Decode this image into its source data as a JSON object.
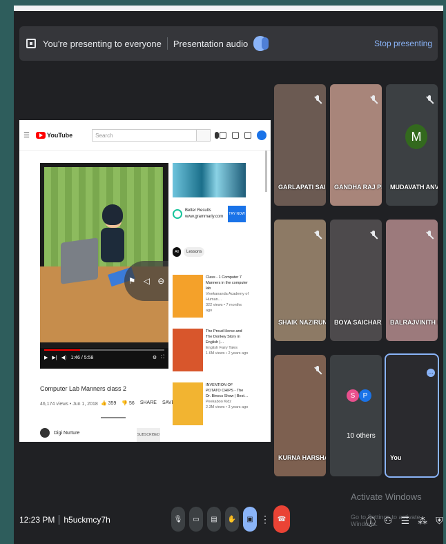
{
  "banner": {
    "presenting_text": "You're presenting to everyone",
    "audio_label": "Presentation audio",
    "stop_label": "Stop presenting"
  },
  "youtube": {
    "brand": "YouTube",
    "search_placeholder": "Search",
    "video_title": "Computer Lab Manners class 2",
    "video_meta": "46,174 views • Jun 1, 2018",
    "likes": "359",
    "dislikes": "56",
    "share_label": "SHARE",
    "save_label": "SAVE",
    "channel_name": "Digi Nurture",
    "subscribe_label": "SUBSCRIBED",
    "player_time": "1:46 / 5:58",
    "ad": {
      "title": "Better Results",
      "url": "www.grammarly.com",
      "button": "TRY NOW"
    },
    "chips": [
      "All",
      "Lessons"
    ],
    "recommendations": [
      {
        "title": "Class - 1 Computer 7 Manners in the computer lab",
        "channel": "Vivekananda Academy of Human…",
        "meta": "322 views • 7 months ago",
        "color": "#f4a12a"
      },
      {
        "title": "The Proud Horse and The Donkey Story in English |…",
        "channel": "English Fairy Tales",
        "meta": "1.6M views • 2 years ago",
        "color": "#d8562c"
      },
      {
        "title": "INVENTION OF POTATO CHIPS - The Dr. Binocs Show | Best…",
        "channel": "Peekaboo Kidz",
        "meta": "2.3M views • 3 years ago",
        "color": "#f2b431"
      }
    ]
  },
  "participants": [
    {
      "name": "GARLAPATI SAIS...",
      "bg": "#6b5a52"
    },
    {
      "name": "GANDHA RAJ PRA...",
      "bg": "#a8857a"
    },
    {
      "name": "MUDAVATH ANVIT...",
      "bg": "#3c4043",
      "initial": "M"
    },
    {
      "name": "SHAIK NAZIRUNN...",
      "bg": "#8d7a65"
    },
    {
      "name": "BOYA SAICHARAN...",
      "bg": "#4d4a4c"
    },
    {
      "name": "BALRAJVINITH IB",
      "bg": "#9c7a7c"
    },
    {
      "name": "KURNA HARSHA V...",
      "bg": "#7d6050"
    },
    {
      "name": "10 others",
      "bg": "#3c4043"
    },
    {
      "name": "You",
      "bg": "#2a2a2e"
    }
  ],
  "others_avatars": [
    {
      "letter": "S",
      "color": "#e8508d"
    },
    {
      "letter": "P",
      "color": "#1a73e8"
    }
  ],
  "bottom": {
    "time": "12:23 PM",
    "meeting_code": "h5uckmcy7h",
    "watermark_title": "Activate Windows",
    "watermark_sub": "Go to Settings to activate Windows."
  },
  "colors": {
    "accent": "#8ab4f8",
    "end_call": "#ea4335",
    "background": "#202124"
  }
}
